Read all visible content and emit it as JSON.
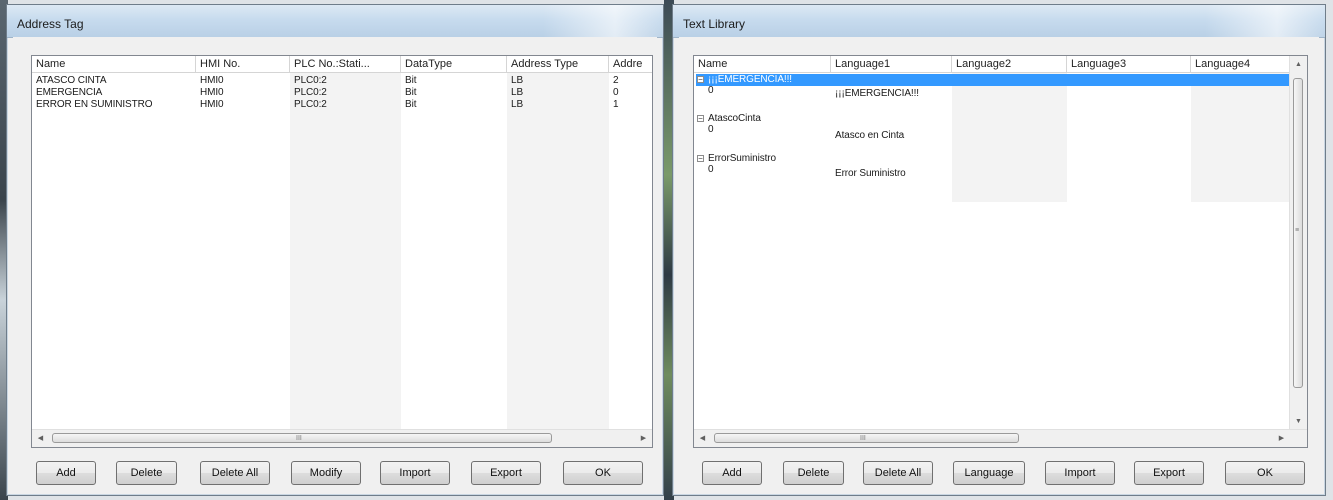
{
  "address_tag": {
    "title": "Address Tag",
    "columns": [
      "Name",
      "HMI No.",
      "PLC No.:Stati...",
      "DataType",
      "Address Type",
      "Addre"
    ],
    "rows": [
      [
        "ATASCO CINTA",
        "HMI0",
        "PLC0:2",
        "Bit",
        "LB",
        "2"
      ],
      [
        "EMERGENCIA",
        "HMI0",
        "PLC0:2",
        "Bit",
        "LB",
        "0"
      ],
      [
        "ERROR EN SUMINISTRO",
        "HMI0",
        "PLC0:2",
        "Bit",
        "LB",
        "1"
      ]
    ],
    "scroll_grip": "III",
    "buttons": [
      "Add",
      "Delete",
      "Delete All",
      "Modify",
      "Import",
      "Export",
      "OK"
    ]
  },
  "text_library": {
    "title": "Text Library",
    "columns": [
      "Name",
      "Language1",
      "Language2",
      "Language3",
      "Language4"
    ],
    "groups": [
      {
        "name": "¡¡¡EMERGENCIA!!!",
        "state": "0",
        "text": "¡¡¡EMERGENCIA!!!",
        "selected": true
      },
      {
        "name": "AtascoCinta",
        "state": "0",
        "text": "Atasco en Cinta",
        "selected": false
      },
      {
        "name": "ErrorSuministro",
        "state": "0",
        "text": "Error Suministro",
        "selected": false
      }
    ],
    "tree_toggle": "−",
    "scroll_grip": "III",
    "buttons": [
      "Add",
      "Delete",
      "Delete All",
      "Language",
      "Import",
      "Export",
      "OK"
    ]
  },
  "colors": {
    "selection": "#3399ff",
    "titlebar": "#c7dbee",
    "window_bg": "#f0f0f0"
  }
}
